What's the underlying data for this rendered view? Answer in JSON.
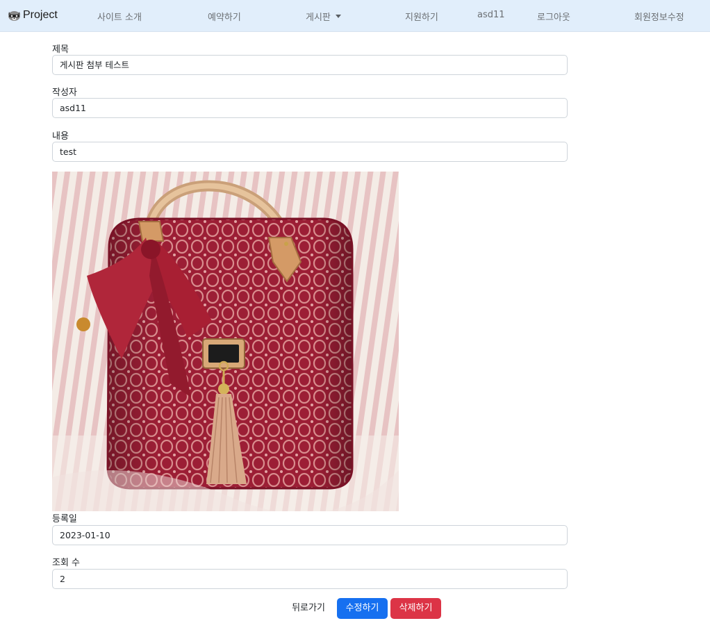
{
  "navbar": {
    "brand": "Project",
    "links": {
      "about": "사이트 소개",
      "reserve": "예약하기",
      "board": "게시판",
      "apply": "지원하기",
      "user": "asd11",
      "logout": "로그아웃",
      "profile_edit": "회원정보수정"
    }
  },
  "form": {
    "title_label": "제목",
    "title_value": "게시판 첨부 테스트",
    "author_label": "작성자",
    "author_value": "asd11",
    "content_label": "내용",
    "content_value": "test",
    "date_label": "등록일",
    "date_value": "2023-01-10",
    "views_label": "조회 수",
    "views_value": "2"
  },
  "attachment": {
    "icon": "red-handbag-photo"
  },
  "buttons": {
    "back": "뒤로가기",
    "edit": "수정하기",
    "delete": "삭제하기"
  },
  "colors": {
    "navbar_bg": "#e1eefb",
    "primary": "#1670f0",
    "danger": "#dc3446"
  }
}
